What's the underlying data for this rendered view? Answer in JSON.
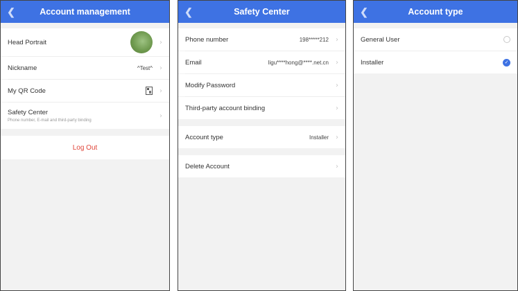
{
  "colors": {
    "accent": "#3e72e3",
    "danger": "#e0463a"
  },
  "panel1": {
    "title": "Account management",
    "rows": {
      "head_portrait": "Head Portrait",
      "nickname": "Nickname",
      "nickname_value": "^Test^",
      "qr_code": "My QR Code",
      "safety_center": "Safety Center",
      "safety_center_sub": "Phone number, E-mail and third-party binding"
    },
    "logout": "Log Out"
  },
  "panel2": {
    "title": "Safety Center",
    "rows": {
      "phone": "Phone number",
      "phone_value": "198*****212",
      "email": "Email",
      "email_value": "ligu****hong@****.net.cn",
      "modify_password": "Modify Password",
      "third_party": "Third-party account binding",
      "account_type": "Account type",
      "account_type_value": "Installer",
      "delete_account": "Delete Account"
    }
  },
  "panel3": {
    "title": "Account type",
    "options": [
      {
        "label": "General User",
        "selected": false
      },
      {
        "label": "Installer",
        "selected": true
      }
    ]
  }
}
